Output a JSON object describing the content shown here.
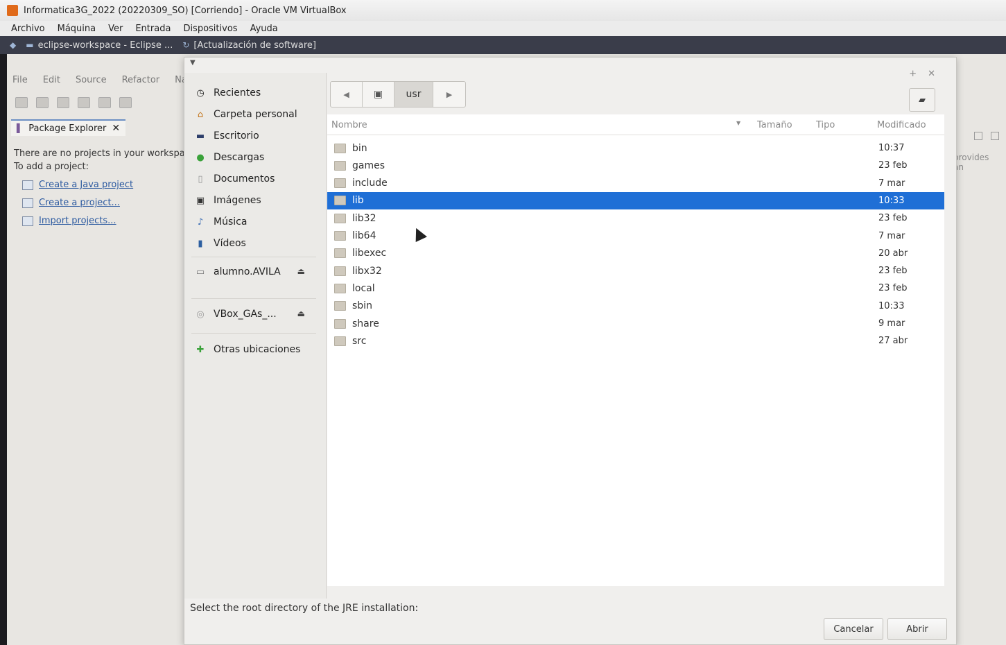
{
  "vbox": {
    "title": "Informatica3G_2022 (20220309_SO) [Corriendo] - Oracle VM VirtualBox",
    "menu": [
      "Archivo",
      "Máquina",
      "Ver",
      "Entrada",
      "Dispositivos",
      "Ayuda"
    ]
  },
  "panel": {
    "task1": "eclipse-workspace - Eclipse ...",
    "task2": "[Actualización de software]"
  },
  "eclipse": {
    "menu": [
      "File",
      "Edit",
      "Source",
      "Refactor",
      "Na"
    ],
    "package_tab": "Package Explorer",
    "empty_line1": "There are no projects in your workspa",
    "empty_line2": "To add a project:",
    "links": [
      "Create a Java project",
      "Create a project...",
      "Import projects..."
    ],
    "right_text": "provides an"
  },
  "dialog": {
    "places": [
      {
        "label": "Recientes",
        "icon": "clock-icon"
      },
      {
        "label": "Carpeta personal",
        "icon": "home-icon"
      },
      {
        "label": "Escritorio",
        "icon": "desktop-icon"
      },
      {
        "label": "Descargas",
        "icon": "download-icon"
      },
      {
        "label": "Documentos",
        "icon": "document-icon"
      },
      {
        "label": "Imágenes",
        "icon": "image-icon"
      },
      {
        "label": "Música",
        "icon": "music-icon"
      },
      {
        "label": "Vídeos",
        "icon": "video-icon"
      }
    ],
    "devices": [
      "alumno.AVILA",
      "VBox_GAs_..."
    ],
    "other": "Otras ubicaciones",
    "path_segment": "usr",
    "columns": {
      "name": "Nombre",
      "size": "Tamaño",
      "type": "Tipo",
      "modified": "Modificado"
    },
    "rows": [
      {
        "name": "bin",
        "modified": "10:37"
      },
      {
        "name": "games",
        "modified": "23 feb"
      },
      {
        "name": "include",
        "modified": "7 mar"
      },
      {
        "name": "lib",
        "modified": "10:33"
      },
      {
        "name": "lib32",
        "modified": "23 feb"
      },
      {
        "name": "lib64",
        "modified": "7 mar"
      },
      {
        "name": "libexec",
        "modified": "20 abr"
      },
      {
        "name": "libx32",
        "modified": "23 feb"
      },
      {
        "name": "local",
        "modified": "23 feb"
      },
      {
        "name": "sbin",
        "modified": "10:33"
      },
      {
        "name": "share",
        "modified": "9 mar"
      },
      {
        "name": "src",
        "modified": "27 abr"
      }
    ],
    "selected_row": "lib",
    "footer_text": "Select the root directory of the JRE installation:",
    "cancel_label": "Cancelar",
    "open_label": "Abrir"
  }
}
